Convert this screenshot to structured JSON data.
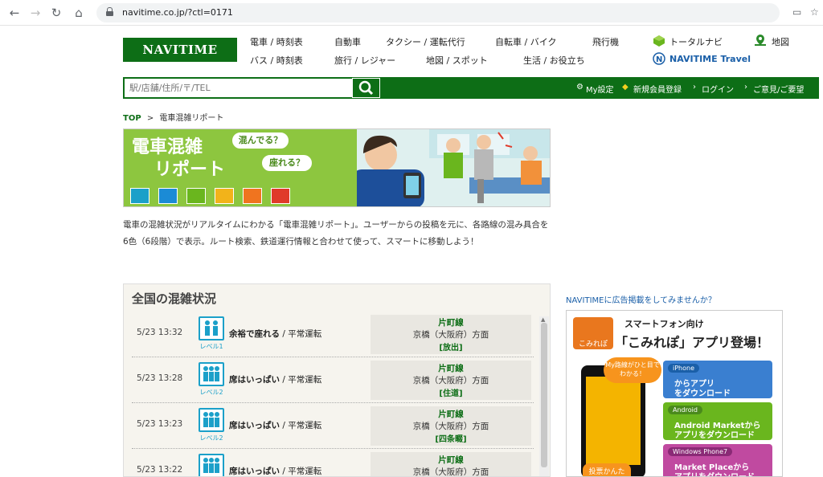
{
  "browser": {
    "url": "navitime.co.jp/?ctl=0171"
  },
  "header": {
    "logo": "NAVITIME",
    "nav_row1": [
      "電車 / 時刻表",
      "自動車",
      "タクシー / 運転代行",
      "自転車 / バイク",
      "飛行機",
      "トータルナビ",
      "地図"
    ],
    "nav_row2": [
      "バス / 時刻表",
      "旅行 / レジャー",
      "地図 / スポット",
      "生活 / お役立ち",
      "NAVITIME Travel"
    ]
  },
  "search": {
    "placeholder": "駅/店舗/住所/〒/TEL"
  },
  "util_links": [
    "My設定",
    "新規会員登録",
    "ログイン",
    "ご意見/ご要望"
  ],
  "breadcrumb": {
    "home": "TOP",
    "sep": ">",
    "current": "電車混雑リポート"
  },
  "banner": {
    "title1": "電車混雑",
    "title2": "リポート",
    "bubble1": "混んでる？",
    "bubble2": "座れる？",
    "level_colors": [
      "#1ba0c9",
      "#1b8bd6",
      "#6ab61e",
      "#f2b31a",
      "#f0741f",
      "#e03a2a"
    ]
  },
  "description": "電車の混雑状況がリアルタイムにわかる「電車混雑リポート」。ユーザーからの投稿を元に、各路線の混み具合を6色（6段階）で表示。ルート検索、鉄道運行情報と合わせて使って、スマートに移動しよう！",
  "panel": {
    "title": "全国の混雑状況",
    "rows": [
      {
        "time": "5/23 13:32",
        "level": "レベル1",
        "status": "余裕で座れる",
        "op": "平常運転",
        "line": "片町線",
        "dir": "京橋（大阪府）方面",
        "station": "[放出]"
      },
      {
        "time": "5/23 13:28",
        "level": "レベル2",
        "status": "席はいっぱい",
        "op": "平常運転",
        "line": "片町線",
        "dir": "京橋（大阪府）方面",
        "station": "[住道]"
      },
      {
        "time": "5/23 13:23",
        "level": "レベル2",
        "status": "席はいっぱい",
        "op": "平常運転",
        "line": "片町線",
        "dir": "京橋（大阪府）方面",
        "station": "[四条畷]"
      },
      {
        "time": "5/23 13:22",
        "level": "",
        "status": "席はいっぱい",
        "op": "平常運転",
        "line": "片町線",
        "dir": "京橋（大阪府）方面",
        "station": ""
      }
    ]
  },
  "sidebar": {
    "ad_link": "NAVITIMEに広告掲載をしてみませんか？",
    "ad": {
      "app_name": "こみれぽ",
      "head": "スマートフォン向け",
      "head2": "「こみれぽ」アプリ登場！",
      "bubble": "My路線がひと目でわかる！",
      "bottom": "投票かんたん！",
      "stores": [
        {
          "tag": "iPhone",
          "l1": "からアプリ",
          "l2": "をダウンロード",
          "color": "#3a7fd0"
        },
        {
          "tag": "Android",
          "l1": "Android Marketから",
          "l2": "アプリをダウンロード",
          "color": "#6ab61e"
        },
        {
          "tag": "Windows Phone7",
          "l1": "Market Placeから",
          "l2": "アプリをダウンロード",
          "color": "#c04aa0"
        }
      ]
    }
  }
}
